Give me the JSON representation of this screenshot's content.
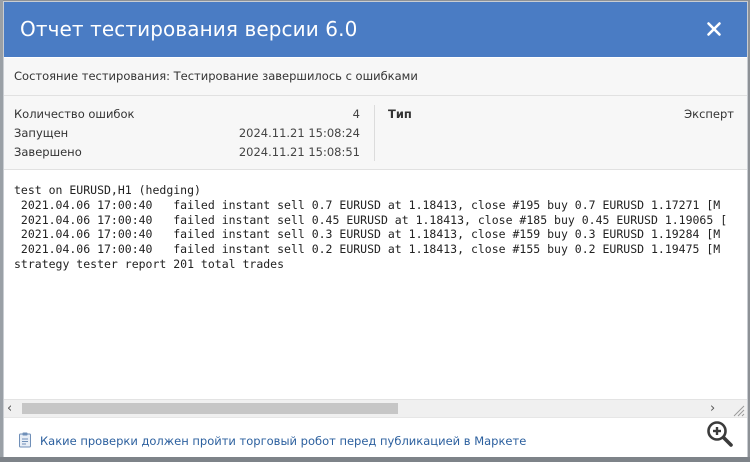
{
  "dialog": {
    "title": "Отчет тестирования версии 6.0",
    "close_icon": "close-icon",
    "status": "Состояние тестирования: Тестирование завершилось с ошибками",
    "info": {
      "errors_label": "Количество ошибок",
      "errors_value": "4",
      "started_label": "Запущен",
      "started_value": "2024.11.21 15:08:24",
      "finished_label": "Завершено",
      "finished_value": "2024.11.21 15:08:51",
      "type_label": "Тип",
      "type_value": "Эксперт"
    },
    "log": "test on EURUSD,H1 (hedging)\n 2021.04.06 17:00:40   failed instant sell 0.7 EURUSD at 1.18413, close #195 buy 0.7 EURUSD 1.17271 [M\n 2021.04.06 17:00:40   failed instant sell 0.45 EURUSD at 1.18413, close #185 buy 0.45 EURUSD 1.19065 [\n 2021.04.06 17:00:40   failed instant sell 0.3 EURUSD at 1.18413, close #159 buy 0.3 EURUSD 1.19284 [M\n 2021.04.06 17:00:40   failed instant sell 0.2 EURUSD at 1.18413, close #155 buy 0.2 EURUSD 1.19475 [M\nstrategy tester report 201 total trades",
    "scroll": {
      "left_arrow": "‹",
      "right_arrow": "›",
      "left_icon": "chevron-left-icon",
      "right_icon": "chevron-right-icon",
      "grip_icon": "resize-grip-icon"
    },
    "footer": {
      "icon": "document-icon",
      "link_text": "Какие проверки должен пройти торговый робот перед публикацией в Маркете"
    }
  },
  "zoom_icon": "zoom-in-icon",
  "colors": {
    "title_bar": "#4a7cc4",
    "link": "#2b5f9e",
    "panel": "#f7f7f7"
  }
}
